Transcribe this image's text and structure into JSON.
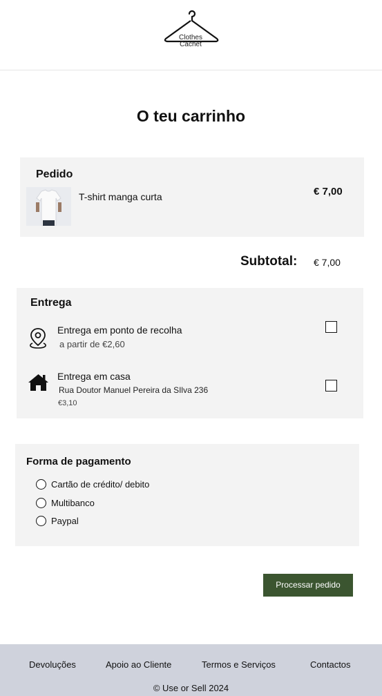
{
  "header": {
    "logo_line1": "Clothes",
    "logo_line2": "Cachet"
  },
  "page_title": "O teu carrinho",
  "order": {
    "heading": "Pedido",
    "items": [
      {
        "name": "T-shirt manga curta",
        "price": "€ 7,00"
      }
    ]
  },
  "subtotal": {
    "label": "Subtotal:",
    "value": "€ 7,00"
  },
  "delivery": {
    "heading": "Entrega",
    "options": [
      {
        "title": "Entrega em ponto de recolha",
        "subtitle": "a partir de €2,60",
        "icon": "map-pin-icon",
        "checked": false
      },
      {
        "title": "Entrega em casa",
        "address": "Rua Doutor Manuel Pereira da SIlva 236",
        "price": "€3,10",
        "icon": "house-icon",
        "checked": false
      }
    ]
  },
  "payment": {
    "heading": "Forma de pagamento",
    "options": [
      {
        "label": "Cartão de crédito/ debito"
      },
      {
        "label": "Multibanco"
      },
      {
        "label": "Paypal"
      }
    ]
  },
  "actions": {
    "process_label": "Processar pedido"
  },
  "footer": {
    "links": [
      {
        "label": "Devoluções"
      },
      {
        "label": "Apoio ao Cliente"
      },
      {
        "label": "Termos e Serviços"
      },
      {
        "label": "Contactos"
      }
    ],
    "copyright": "© Use or Sell 2024"
  },
  "colors": {
    "accent": "#3b5530",
    "panel": "#f3f3f3",
    "footer": "#cfd2dc"
  }
}
